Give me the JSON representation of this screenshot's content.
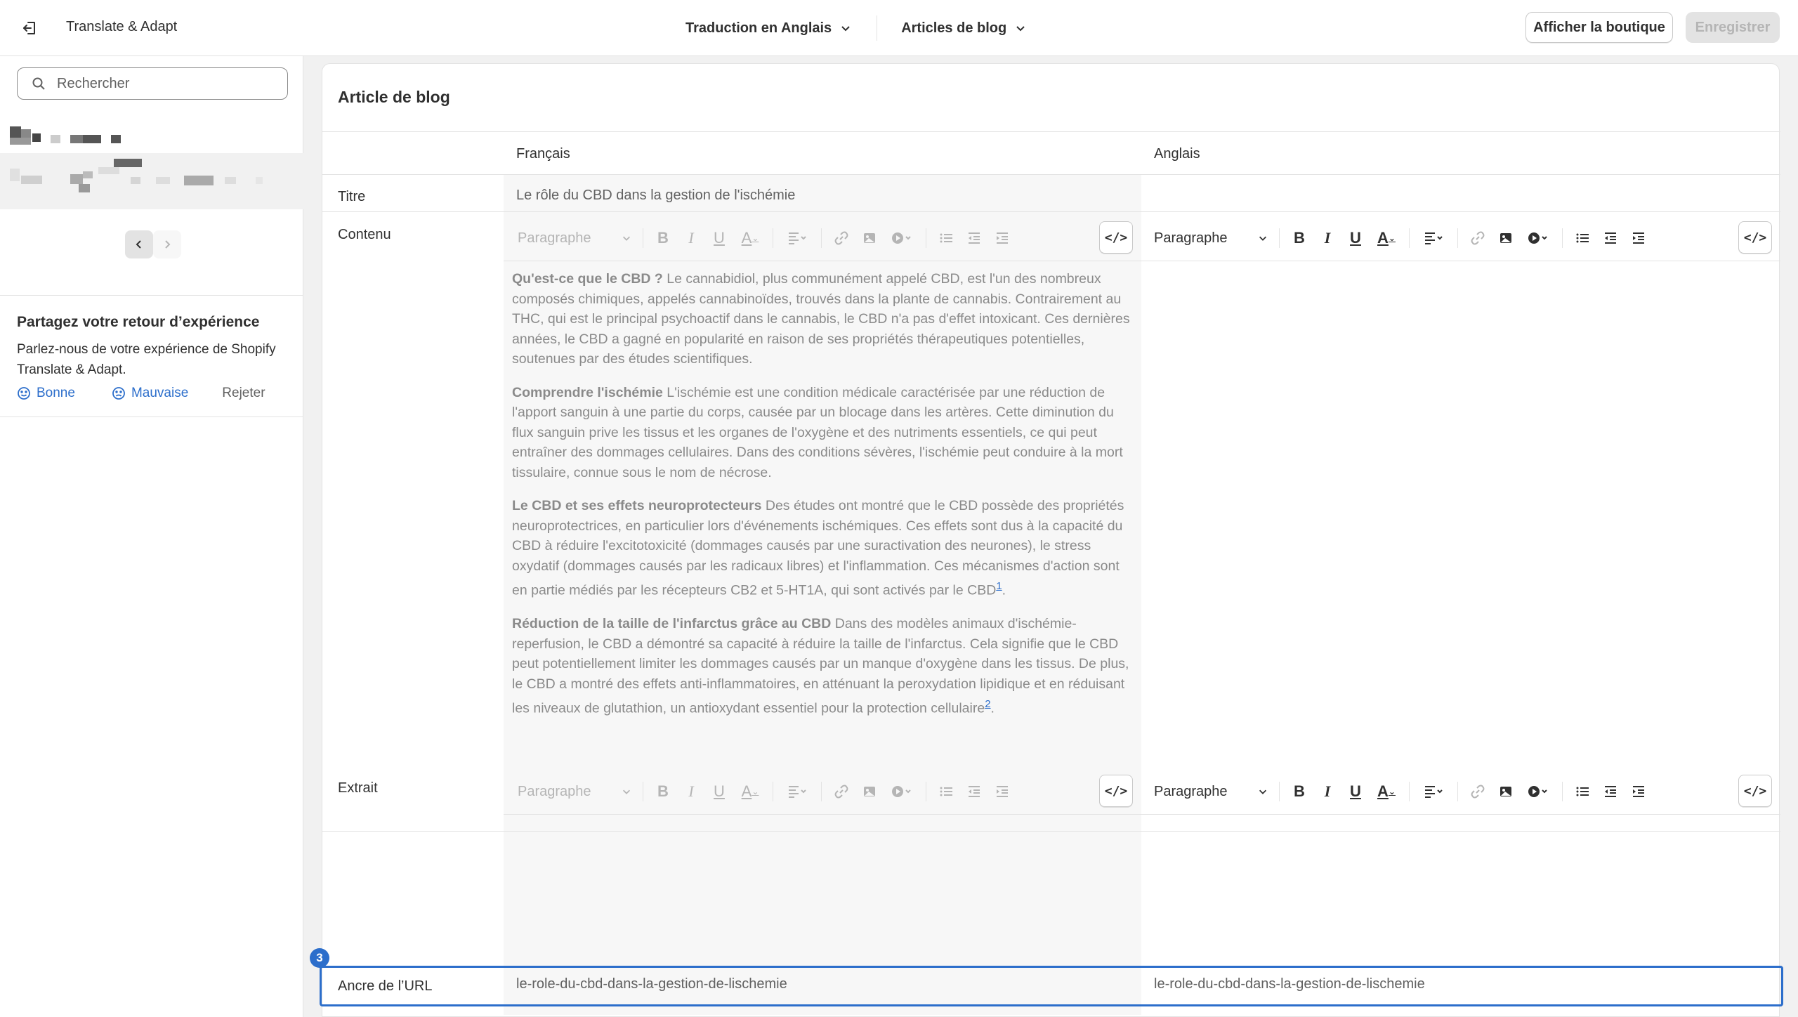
{
  "app": {
    "title": "Translate & Adapt"
  },
  "topbar": {
    "language_selector": "Traduction en Anglais",
    "resource_selector": "Articles de blog",
    "view_store_label": "Afficher la boutique",
    "save_label": "Enregistrer"
  },
  "sidebar": {
    "search_placeholder": "Rechercher",
    "feedback": {
      "title": "Partagez votre retour d’expérience",
      "text": "Parlez-nous de votre expérience de Shopify Translate & Adapt.",
      "good_label": "Bonne",
      "bad_label": "Mauvaise",
      "dismiss_label": "Rejeter"
    }
  },
  "main": {
    "card_title": "Article de blog",
    "columns": {
      "source": "Français",
      "target": "Anglais"
    },
    "rows": {
      "title_label": "Titre",
      "title_source": "Le rôle du CBD dans la gestion de l'ischémie",
      "content_label": "Contenu",
      "excerpt_label": "Extrait",
      "url_label": "Ancre de l’URL",
      "url_source": "le-role-du-cbd-dans-la-gestion-de-lischemie",
      "url_target": "le-role-du-cbd-dans-la-gestion-de-lischemie"
    },
    "toolbar": {
      "paragraph_label": "Paragraphe",
      "code_label": "</>"
    },
    "content": {
      "p1_head": "Qu'est-ce que le CBD ?",
      "p1_body": " Le cannabidiol, plus communément appelé CBD, est l'un des nombreux composés chimiques, appelés cannabinoïdes, trouvés dans la plante de cannabis. Contrairement au THC, qui est le principal psychoactif dans le cannabis, le CBD n'a pas d'effet intoxicant. Ces dernières années, le CBD a gagné en popularité en raison de ses propriétés thérapeutiques potentielles, soutenues par des études scientifiques.",
      "p2_head": "Comprendre l'ischémie",
      "p2_body": " L'ischémie est une condition médicale caractérisée par une réduction de l'apport sanguin à une partie du corps, causée par un blocage dans les artères. Cette diminution du flux sanguin prive les tissus et les organes de l'oxygène et des nutriments essentiels, ce qui peut entraîner des dommages cellulaires. Dans des conditions sévères, l'ischémie peut conduire à la mort tissulaire, connue sous le nom de nécrose.",
      "p3_head": "Le CBD et ses effets neuroprotecteurs",
      "p3_body": " Des études ont montré que le CBD possède des propriétés neuroprotectrices, en particulier lors d'événements ischémiques. Ces effets sont dus à la capacité du CBD à réduire l'excitotoxicité (dommages causés par une suractivation des neurones), le stress oxydatif (dommages causés par les radicaux libres) et l'inflammation. Ces mécanismes d'action sont en partie médiés par les récepteurs CB2 et 5-HT1A, qui sont activés par le CBD",
      "p3_ref": "1",
      "p4_head": "Réduction de la taille de l'infarctus grâce au CBD",
      "p4_body": " Dans des modèles animaux d'ischémie-reperfusion, le CBD a démontré sa capacité à réduire la taille de l'infarctus. Cela signifie que le CBD peut potentiellement limiter les dommages causés par un manque d'oxygène dans les tissus. De plus, le CBD a montré des effets anti-inflammatoires, en atténuant la peroxydation lipidique et en réduisant les niveaux de glutathion, un antioxydant essentiel pour la protection cellulaire",
      "p4_ref": "2",
      "period": "."
    },
    "focus_badge": "3"
  }
}
